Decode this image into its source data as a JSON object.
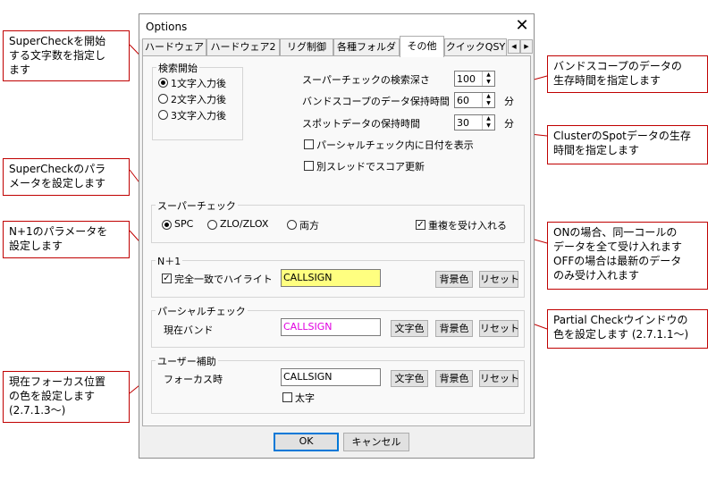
{
  "dialog": {
    "title": "Options",
    "close_label": "✕",
    "tabs": [
      "ハードウェア",
      "ハードウェア2",
      "リグ制御",
      "各種フォルダ",
      "その他",
      "クイックQSY"
    ],
    "active_tab": "その他",
    "tab_scroll_left": "◀",
    "tab_scroll_right": "▶",
    "search_start": {
      "label": "検索開始",
      "options": [
        "1文字入力後",
        "2文字入力後",
        "3文字入力後"
      ],
      "selected": "1文字入力後"
    },
    "super_search_depth": {
      "label": "スーパーチェックの検索深さ",
      "value": "100"
    },
    "band_scope_hold": {
      "label": "バンドスコープのデータ保持時間",
      "value": "60",
      "unit": "分"
    },
    "spot_hold": {
      "label": "スポットデータの保持時間",
      "value": "30",
      "unit": "分"
    },
    "show_date_in_partial": {
      "label": "パーシャルチェック内に日付を表示",
      "checked": false
    },
    "score_thread": {
      "label": "別スレッドでスコア更新",
      "checked": false
    },
    "supercheck": {
      "label": "スーパーチェック",
      "options": [
        "SPC",
        "ZLO/ZLOX",
        "両方"
      ],
      "selected": "SPC",
      "accept_dupes": {
        "label": "重複を受け入れる",
        "checked": true
      }
    },
    "n1": {
      "label": "N＋1",
      "exact_highlight": {
        "label": "完全一致でハイライト",
        "checked": true
      },
      "sample": "CALLSIGN",
      "bg_button": "背景色",
      "reset_button": "リセット"
    },
    "partial": {
      "label": "パーシャルチェック",
      "row_label": "現在バンド",
      "sample": "CALLSIGN",
      "text_button": "文字色",
      "bg_button": "背景色",
      "reset_button": "リセット"
    },
    "user_assist": {
      "label": "ユーザー補助",
      "row_label": "フォーカス時",
      "sample": "CALLSIGN",
      "text_button": "文字色",
      "bg_button": "背景色",
      "reset_button": "リセット",
      "bold": {
        "label": "太字",
        "checked": false
      }
    },
    "ok_button": "OK",
    "cancel_button": "キャンセル"
  },
  "callouts": {
    "c1": [
      "SuperCheckを開始",
      "する文字数を指定し",
      "ます"
    ],
    "c2": [
      "SuperCheckのパラ",
      "メータを設定します"
    ],
    "c3": [
      "N+1のパラメータを",
      "設定します"
    ],
    "c4": [
      "現在フォーカス位置",
      "の色を設定します",
      "(2.7.1.3〜)"
    ],
    "c5": [
      "バンドスコープのデータの",
      "生存時間を指定します"
    ],
    "c6": [
      "ClusterのSpotデータの生存",
      "時間を指定します"
    ],
    "c7": [
      "ONの場合、同一コールの",
      "データを全て受け入れます",
      "OFFの場合は最新のデータ",
      "のみ受け入れます"
    ],
    "c8": [
      "Partial Checkウインドウの",
      "色を設定します (2.7.1.1〜)"
    ]
  },
  "colors": {
    "callout_border": "#c00000",
    "n1_sample_bg": "#ffff80",
    "partial_sample_fg": "#e000e0",
    "accent": "#0078d7"
  }
}
